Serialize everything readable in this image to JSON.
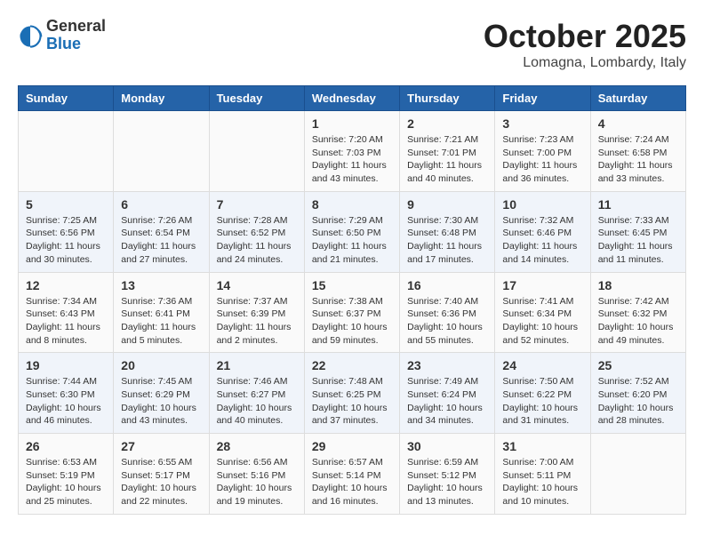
{
  "header": {
    "logo": {
      "general": "General",
      "blue": "Blue"
    },
    "title": "October 2025",
    "location": "Lomagna, Lombardy, Italy"
  },
  "calendar": {
    "weekdays": [
      "Sunday",
      "Monday",
      "Tuesday",
      "Wednesday",
      "Thursday",
      "Friday",
      "Saturday"
    ],
    "weeks": [
      [
        {
          "day": "",
          "info": ""
        },
        {
          "day": "",
          "info": ""
        },
        {
          "day": "",
          "info": ""
        },
        {
          "day": "1",
          "info": "Sunrise: 7:20 AM\nSunset: 7:03 PM\nDaylight: 11 hours\nand 43 minutes."
        },
        {
          "day": "2",
          "info": "Sunrise: 7:21 AM\nSunset: 7:01 PM\nDaylight: 11 hours\nand 40 minutes."
        },
        {
          "day": "3",
          "info": "Sunrise: 7:23 AM\nSunset: 7:00 PM\nDaylight: 11 hours\nand 36 minutes."
        },
        {
          "day": "4",
          "info": "Sunrise: 7:24 AM\nSunset: 6:58 PM\nDaylight: 11 hours\nand 33 minutes."
        }
      ],
      [
        {
          "day": "5",
          "info": "Sunrise: 7:25 AM\nSunset: 6:56 PM\nDaylight: 11 hours\nand 30 minutes."
        },
        {
          "day": "6",
          "info": "Sunrise: 7:26 AM\nSunset: 6:54 PM\nDaylight: 11 hours\nand 27 minutes."
        },
        {
          "day": "7",
          "info": "Sunrise: 7:28 AM\nSunset: 6:52 PM\nDaylight: 11 hours\nand 24 minutes."
        },
        {
          "day": "8",
          "info": "Sunrise: 7:29 AM\nSunset: 6:50 PM\nDaylight: 11 hours\nand 21 minutes."
        },
        {
          "day": "9",
          "info": "Sunrise: 7:30 AM\nSunset: 6:48 PM\nDaylight: 11 hours\nand 17 minutes."
        },
        {
          "day": "10",
          "info": "Sunrise: 7:32 AM\nSunset: 6:46 PM\nDaylight: 11 hours\nand 14 minutes."
        },
        {
          "day": "11",
          "info": "Sunrise: 7:33 AM\nSunset: 6:45 PM\nDaylight: 11 hours\nand 11 minutes."
        }
      ],
      [
        {
          "day": "12",
          "info": "Sunrise: 7:34 AM\nSunset: 6:43 PM\nDaylight: 11 hours\nand 8 minutes."
        },
        {
          "day": "13",
          "info": "Sunrise: 7:36 AM\nSunset: 6:41 PM\nDaylight: 11 hours\nand 5 minutes."
        },
        {
          "day": "14",
          "info": "Sunrise: 7:37 AM\nSunset: 6:39 PM\nDaylight: 11 hours\nand 2 minutes."
        },
        {
          "day": "15",
          "info": "Sunrise: 7:38 AM\nSunset: 6:37 PM\nDaylight: 10 hours\nand 59 minutes."
        },
        {
          "day": "16",
          "info": "Sunrise: 7:40 AM\nSunset: 6:36 PM\nDaylight: 10 hours\nand 55 minutes."
        },
        {
          "day": "17",
          "info": "Sunrise: 7:41 AM\nSunset: 6:34 PM\nDaylight: 10 hours\nand 52 minutes."
        },
        {
          "day": "18",
          "info": "Sunrise: 7:42 AM\nSunset: 6:32 PM\nDaylight: 10 hours\nand 49 minutes."
        }
      ],
      [
        {
          "day": "19",
          "info": "Sunrise: 7:44 AM\nSunset: 6:30 PM\nDaylight: 10 hours\nand 46 minutes."
        },
        {
          "day": "20",
          "info": "Sunrise: 7:45 AM\nSunset: 6:29 PM\nDaylight: 10 hours\nand 43 minutes."
        },
        {
          "day": "21",
          "info": "Sunrise: 7:46 AM\nSunset: 6:27 PM\nDaylight: 10 hours\nand 40 minutes."
        },
        {
          "day": "22",
          "info": "Sunrise: 7:48 AM\nSunset: 6:25 PM\nDaylight: 10 hours\nand 37 minutes."
        },
        {
          "day": "23",
          "info": "Sunrise: 7:49 AM\nSunset: 6:24 PM\nDaylight: 10 hours\nand 34 minutes."
        },
        {
          "day": "24",
          "info": "Sunrise: 7:50 AM\nSunset: 6:22 PM\nDaylight: 10 hours\nand 31 minutes."
        },
        {
          "day": "25",
          "info": "Sunrise: 7:52 AM\nSunset: 6:20 PM\nDaylight: 10 hours\nand 28 minutes."
        }
      ],
      [
        {
          "day": "26",
          "info": "Sunrise: 6:53 AM\nSunset: 5:19 PM\nDaylight: 10 hours\nand 25 minutes."
        },
        {
          "day": "27",
          "info": "Sunrise: 6:55 AM\nSunset: 5:17 PM\nDaylight: 10 hours\nand 22 minutes."
        },
        {
          "day": "28",
          "info": "Sunrise: 6:56 AM\nSunset: 5:16 PM\nDaylight: 10 hours\nand 19 minutes."
        },
        {
          "day": "29",
          "info": "Sunrise: 6:57 AM\nSunset: 5:14 PM\nDaylight: 10 hours\nand 16 minutes."
        },
        {
          "day": "30",
          "info": "Sunrise: 6:59 AM\nSunset: 5:12 PM\nDaylight: 10 hours\nand 13 minutes."
        },
        {
          "day": "31",
          "info": "Sunrise: 7:00 AM\nSunset: 5:11 PM\nDaylight: 10 hours\nand 10 minutes."
        },
        {
          "day": "",
          "info": ""
        }
      ]
    ]
  }
}
